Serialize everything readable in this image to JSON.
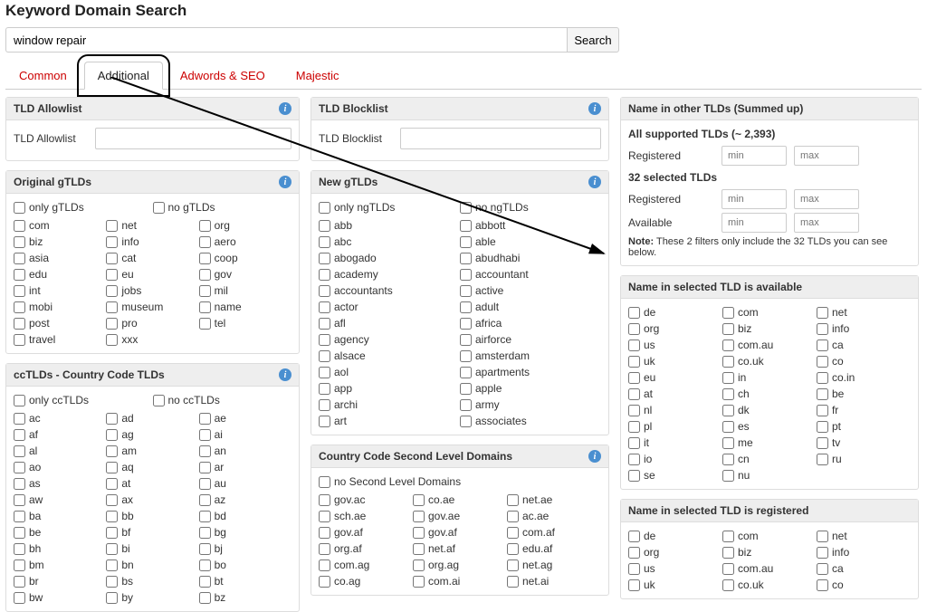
{
  "title": "Keyword Domain Search",
  "search": {
    "value": "window repair",
    "button": "Search"
  },
  "tabs": [
    "Common",
    "Additional",
    "Adwords & SEO",
    "Majestic"
  ],
  "active_tab": 1,
  "left": {
    "allowlist": {
      "header": "TLD Allowlist",
      "field_label": "TLD Allowlist"
    },
    "gtlds": {
      "header": "Original gTLDs",
      "toggles": [
        "only gTLDs",
        "no gTLDs"
      ],
      "items": [
        "com",
        "net",
        "org",
        "biz",
        "info",
        "aero",
        "asia",
        "cat",
        "coop",
        "edu",
        "eu",
        "gov",
        "int",
        "jobs",
        "mil",
        "mobi",
        "museum",
        "name",
        "post",
        "pro",
        "tel",
        "travel",
        "xxx"
      ]
    },
    "cctlds": {
      "header": "ccTLDs - Country Code TLDs",
      "toggles": [
        "only ccTLDs",
        "no ccTLDs"
      ],
      "items": [
        "ac",
        "ad",
        "ae",
        "af",
        "ag",
        "ai",
        "al",
        "am",
        "an",
        "ao",
        "aq",
        "ar",
        "as",
        "at",
        "au",
        "aw",
        "ax",
        "az",
        "ba",
        "bb",
        "bd",
        "be",
        "bf",
        "bg",
        "bh",
        "bi",
        "bj",
        "bm",
        "bn",
        "bo",
        "br",
        "bs",
        "bt",
        "bw",
        "by",
        "bz"
      ]
    }
  },
  "mid": {
    "blocklist": {
      "header": "TLD Blocklist",
      "field_label": "TLD Blocklist"
    },
    "ngtlds": {
      "header": "New gTLDs",
      "toggles": [
        "only ngTLDs",
        "no ngTLDs"
      ],
      "items": [
        "abb",
        "abbott",
        "abc",
        "able",
        "abogado",
        "abudhabi",
        "academy",
        "accountant",
        "accountants",
        "active",
        "actor",
        "adult",
        "afl",
        "africa",
        "agency",
        "airforce",
        "alsace",
        "amsterdam",
        "aol",
        "apartments",
        "app",
        "apple",
        "archi",
        "army",
        "art",
        "associates"
      ]
    },
    "ccsld": {
      "header": "Country Code Second Level Domains",
      "toggle": "no Second Level Domains",
      "items": [
        "gov.ac",
        "co.ae",
        "net.ae",
        "sch.ae",
        "gov.ae",
        "ac.ae",
        "gov.af",
        "gov.af",
        "com.af",
        "org.af",
        "net.af",
        "edu.af",
        "com.ag",
        "org.ag",
        "net.ag",
        "co.ag",
        "com.ai",
        "net.ai"
      ]
    }
  },
  "right": {
    "summed": {
      "header": "Name in other TLDs (Summed up)",
      "all_label": "All supported TLDs (~ 2,393)",
      "registered": "Registered",
      "selected_label": "32 selected TLDs",
      "available": "Available",
      "min": "min",
      "max": "max",
      "note_bold": "Note:",
      "note": "These 2 filters only include the 32 TLDs you can see below."
    },
    "avail": {
      "header": "Name in selected TLD is available",
      "items": [
        "de",
        "com",
        "net",
        "org",
        "biz",
        "info",
        "us",
        "com.au",
        "ca",
        "uk",
        "co.uk",
        "co",
        "eu",
        "in",
        "co.in",
        "at",
        "ch",
        "be",
        "nl",
        "dk",
        "fr",
        "pl",
        "es",
        "pt",
        "it",
        "me",
        "tv",
        "io",
        "cn",
        "ru",
        "se",
        "nu"
      ]
    },
    "reg": {
      "header": "Name in selected TLD is registered",
      "items": [
        "de",
        "com",
        "net",
        "org",
        "biz",
        "info",
        "us",
        "com.au",
        "ca",
        "uk",
        "co.uk",
        "co"
      ]
    }
  }
}
